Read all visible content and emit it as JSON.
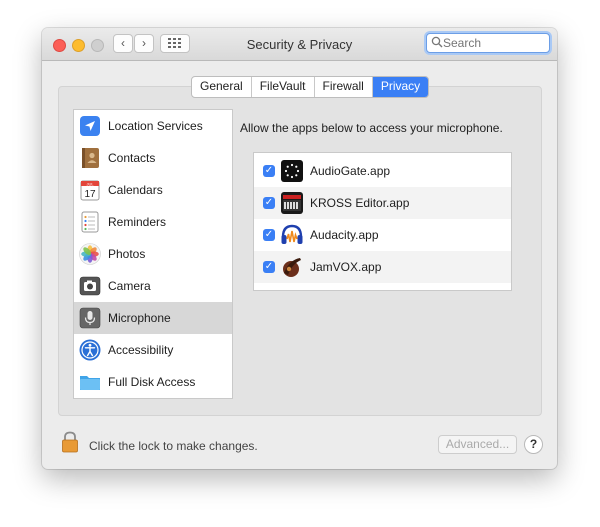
{
  "window": {
    "title": "Security & Privacy"
  },
  "toolbar": {
    "back_glyph": "‹",
    "forward_glyph": "›",
    "grid_icon": "grid-icon"
  },
  "search": {
    "placeholder": "Search",
    "value": ""
  },
  "tabs": [
    {
      "label": "General",
      "active": false
    },
    {
      "label": "FileVault",
      "active": false
    },
    {
      "label": "Firewall",
      "active": false
    },
    {
      "label": "Privacy",
      "active": true
    }
  ],
  "sidebar": {
    "items": [
      {
        "label": "Location Services",
        "icon": "location-arrow-icon",
        "selected": false
      },
      {
        "label": "Contacts",
        "icon": "contacts-book-icon",
        "selected": false
      },
      {
        "label": "Calendars",
        "icon": "calendar-icon",
        "selected": false
      },
      {
        "label": "Reminders",
        "icon": "reminders-list-icon",
        "selected": false
      },
      {
        "label": "Photos",
        "icon": "photos-flower-icon",
        "selected": false
      },
      {
        "label": "Camera",
        "icon": "camera-icon",
        "selected": false
      },
      {
        "label": "Microphone",
        "icon": "microphone-icon",
        "selected": true
      },
      {
        "label": "Accessibility",
        "icon": "accessibility-icon",
        "selected": false
      },
      {
        "label": "Full Disk Access",
        "icon": "folder-icon",
        "selected": false
      }
    ]
  },
  "calendar_icon": {
    "month": "JUL",
    "day": "17"
  },
  "main": {
    "description": "Allow the apps below to access your microphone.",
    "apps": [
      {
        "name": "AudioGate.app",
        "checked": true,
        "icon": "audiogate-icon"
      },
      {
        "name": "KROSS Editor.app",
        "checked": true,
        "icon": "kross-editor-icon"
      },
      {
        "name": "Audacity.app",
        "checked": true,
        "icon": "audacity-headphones-icon"
      },
      {
        "name": "JamVOX.app",
        "checked": true,
        "icon": "jamvox-icon"
      }
    ]
  },
  "footer": {
    "lock_text": "Click the lock to make changes.",
    "advanced_label": "Advanced...",
    "help_label": "?"
  },
  "colors": {
    "accent": "#3a7ff5",
    "selection": "#d7d7d7",
    "lock": "#e89a36"
  }
}
